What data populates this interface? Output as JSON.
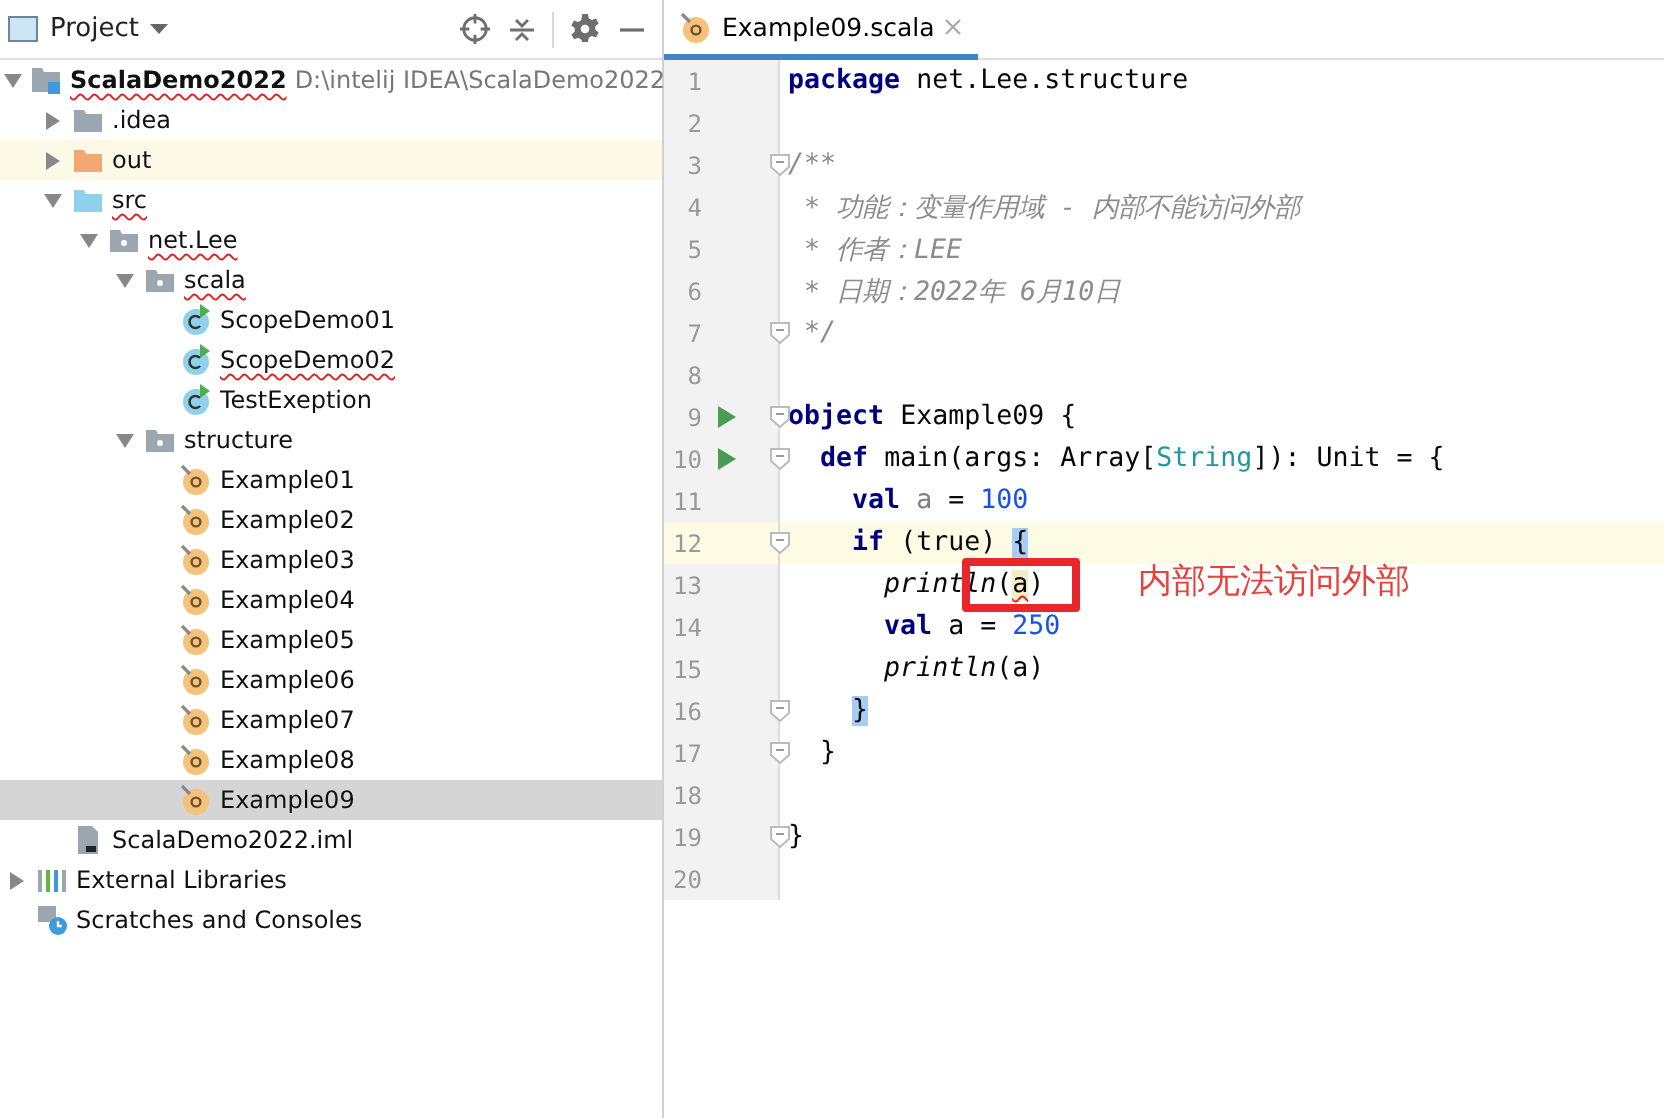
{
  "project_panel": {
    "title": "Project",
    "tree": [
      {
        "label": "ScalaDemo2022",
        "hint": "D:\\intelij IDEA\\ScalaDemo2022",
        "kind": "module",
        "expanded": true,
        "error": true,
        "selected": false,
        "hovered": false,
        "children": [
          {
            "label": ".idea",
            "kind": "folder",
            "expanded": false,
            "error": false,
            "selected": false,
            "hovered": false
          },
          {
            "label": "out",
            "kind": "excluded-folder",
            "expanded": false,
            "error": false,
            "selected": false,
            "hovered": true
          },
          {
            "label": "src",
            "kind": "source-folder",
            "expanded": true,
            "error": true,
            "selected": false,
            "hovered": false,
            "children": [
              {
                "label": "net.Lee",
                "kind": "package",
                "expanded": true,
                "error": true,
                "selected": false,
                "hovered": false,
                "children": [
                  {
                    "label": "scala",
                    "kind": "package",
                    "expanded": true,
                    "error": true,
                    "selected": false,
                    "hovered": false,
                    "children": [
                      {
                        "label": "ScopeDemo01",
                        "kind": "runnable-object",
                        "error": false,
                        "selected": false,
                        "hovered": false
                      },
                      {
                        "label": "ScopeDemo02",
                        "kind": "runnable-object",
                        "error": true,
                        "selected": false,
                        "hovered": false
                      },
                      {
                        "label": "TestExeption",
                        "kind": "runnable-object",
                        "error": false,
                        "selected": false,
                        "hovered": false
                      }
                    ]
                  },
                  {
                    "label": "structure",
                    "kind": "package",
                    "expanded": true,
                    "error": false,
                    "selected": false,
                    "hovered": false,
                    "children": [
                      {
                        "label": "Example01",
                        "kind": "object",
                        "error": false,
                        "selected": false,
                        "hovered": false
                      },
                      {
                        "label": "Example02",
                        "kind": "object",
                        "error": false,
                        "selected": false,
                        "hovered": false
                      },
                      {
                        "label": "Example03",
                        "kind": "object",
                        "error": false,
                        "selected": false,
                        "hovered": false
                      },
                      {
                        "label": "Example04",
                        "kind": "object",
                        "error": false,
                        "selected": false,
                        "hovered": false
                      },
                      {
                        "label": "Example05",
                        "kind": "object",
                        "error": false,
                        "selected": false,
                        "hovered": false
                      },
                      {
                        "label": "Example06",
                        "kind": "object",
                        "error": false,
                        "selected": false,
                        "hovered": false
                      },
                      {
                        "label": "Example07",
                        "kind": "object",
                        "error": false,
                        "selected": false,
                        "hovered": false
                      },
                      {
                        "label": "Example08",
                        "kind": "object",
                        "error": false,
                        "selected": false,
                        "hovered": false
                      },
                      {
                        "label": "Example09",
                        "kind": "object",
                        "error": false,
                        "selected": true,
                        "hovered": false
                      }
                    ]
                  }
                ]
              }
            ]
          },
          {
            "label": "ScalaDemo2022.iml",
            "kind": "iml",
            "error": false,
            "selected": false,
            "hovered": false
          }
        ]
      },
      {
        "label": "External Libraries",
        "kind": "libraries",
        "expanded": false,
        "error": false,
        "selected": false,
        "hovered": false
      },
      {
        "label": "Scratches and Consoles",
        "kind": "scratches",
        "error": false,
        "selected": false,
        "hovered": false
      }
    ]
  },
  "editor": {
    "tabs": [
      {
        "label": "Example09.scala",
        "selected": true
      }
    ],
    "lines": [
      {
        "number": "1",
        "current": false,
        "run": false,
        "fold": false,
        "tokens": [
          {
            "text": "package",
            "kind": "keyword"
          },
          {
            "text": " net.Lee.structure",
            "kind": "plain"
          }
        ]
      },
      {
        "number": "2",
        "current": false,
        "run": false,
        "fold": false
      },
      {
        "number": "3",
        "current": false,
        "run": false,
        "fold": true,
        "tokens": [
          {
            "text": "/**",
            "kind": "comment"
          }
        ]
      },
      {
        "number": "4",
        "current": false,
        "run": false,
        "fold": false,
        "tokens": [
          {
            "text": " * 功能：变量作用域 - 内部不能访问外部",
            "kind": "comment"
          }
        ]
      },
      {
        "number": "5",
        "current": false,
        "run": false,
        "fold": false,
        "tokens": [
          {
            "text": " * 作者：LEE",
            "kind": "comment"
          }
        ]
      },
      {
        "number": "6",
        "current": false,
        "run": false,
        "fold": false,
        "tokens": [
          {
            "text": " * 日期：2022年 6月10日",
            "kind": "comment"
          }
        ]
      },
      {
        "number": "7",
        "current": false,
        "run": false,
        "fold": true,
        "tokens": [
          {
            "text": " */",
            "kind": "comment"
          }
        ]
      },
      {
        "number": "8",
        "current": false,
        "run": false,
        "fold": false
      },
      {
        "number": "9",
        "current": false,
        "run": true,
        "fold": true,
        "tokens": [
          {
            "text": "object",
            "kind": "keyword"
          },
          {
            "text": " Example09 {",
            "kind": "plain"
          }
        ]
      },
      {
        "number": "10",
        "current": false,
        "run": true,
        "fold": true,
        "tokens": [
          {
            "text": "  def",
            "kind": "keyword"
          },
          {
            "text": " main(args: Array[",
            "kind": "plain"
          },
          {
            "text": "String",
            "kind": "type"
          },
          {
            "text": "]): Unit = {",
            "kind": "plain"
          }
        ]
      },
      {
        "number": "11",
        "current": false,
        "run": false,
        "fold": false,
        "tokens": [
          {
            "text": "    val",
            "kind": "keyword"
          },
          {
            "text": " a",
            "kind": "unused"
          },
          {
            "text": " = ",
            "kind": "plain"
          },
          {
            "text": "100",
            "kind": "number"
          }
        ]
      },
      {
        "number": "12",
        "current": true,
        "run": false,
        "fold": true,
        "tokens": [
          {
            "text": "    if",
            "kind": "keyword"
          },
          {
            "text": " (true) ",
            "kind": "plain"
          },
          {
            "text": "{",
            "kind": "brace-match"
          }
        ]
      },
      {
        "number": "13",
        "current": false,
        "run": false,
        "fold": false,
        "tokens": [
          {
            "text": "      println",
            "kind": "call"
          },
          {
            "text": "(",
            "kind": "plain"
          },
          {
            "text": "a",
            "kind": "error"
          },
          {
            "text": ")",
            "kind": "plain"
          }
        ]
      },
      {
        "number": "14",
        "current": false,
        "run": false,
        "fold": false,
        "tokens": [
          {
            "text": "      val",
            "kind": "keyword"
          },
          {
            "text": " a = ",
            "kind": "plain"
          },
          {
            "text": "250",
            "kind": "number"
          }
        ]
      },
      {
        "number": "15",
        "current": false,
        "run": false,
        "fold": false,
        "tokens": [
          {
            "text": "      println",
            "kind": "call"
          },
          {
            "text": "(a)",
            "kind": "plain"
          }
        ]
      },
      {
        "number": "16",
        "current": false,
        "run": false,
        "fold": true,
        "tokens": [
          {
            "text": "    }",
            "kind": "brace-match"
          }
        ]
      },
      {
        "number": "17",
        "current": false,
        "run": false,
        "fold": true,
        "tokens": [
          {
            "text": "  }",
            "kind": "plain"
          }
        ]
      },
      {
        "number": "18",
        "current": false,
        "run": false,
        "fold": false
      },
      {
        "number": "19",
        "current": false,
        "run": false,
        "fold": true,
        "tokens": [
          {
            "text": "}",
            "kind": "plain"
          }
        ]
      },
      {
        "number": "20",
        "current": false,
        "run": false,
        "fold": false
      }
    ],
    "annotation": {
      "text": "内部无法访问外部"
    }
  }
}
